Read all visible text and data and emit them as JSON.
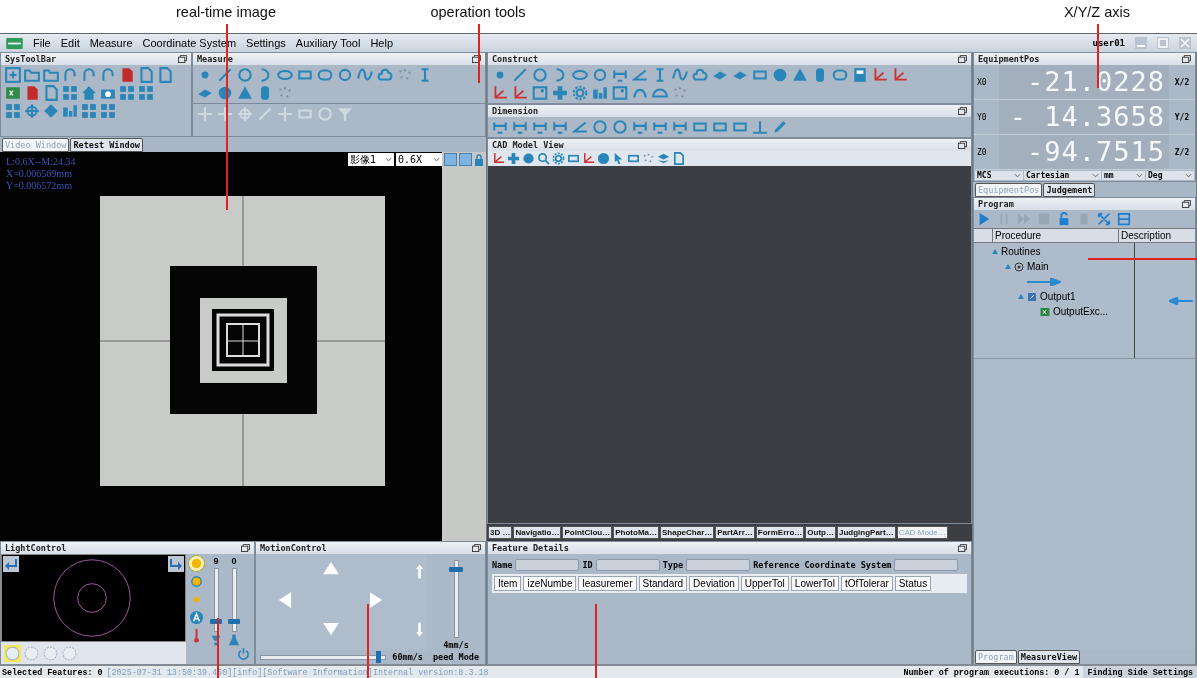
{
  "annotations": [
    {
      "label": "real-time image"
    },
    {
      "label": "operation tools"
    },
    {
      "label": "X/Y/Z axis"
    }
  ],
  "menu": [
    "File",
    "Edit",
    "Measure",
    "Coordinate System",
    "Settings",
    "Auxiliary Tool",
    "Help"
  ],
  "user": "user01",
  "systoolbar": {
    "title": "SysToolBar"
  },
  "measure": {
    "title": "Measure"
  },
  "video": {
    "tabs": [
      {
        "label": "Video Window",
        "selected": true
      },
      {
        "label": "Retest Window",
        "selected": false
      }
    ],
    "overlay": [
      "L:0.6X--M:24.34",
      "X=0.006569mm",
      "Y=0.006572mm"
    ],
    "camera": "影像1",
    "zoom": "0.6X"
  },
  "light_control": {
    "title": "LightControl",
    "ring_modes": [
      {
        "selected": true
      },
      {
        "selected": false
      },
      {
        "selected": false
      },
      {
        "selected": false
      }
    ],
    "sources": [
      {
        "selected": true
      },
      {
        "selected": false
      },
      {
        "selected": false
      }
    ],
    "sliders": [
      {
        "reading": "9",
        "level": 0.12
      },
      {
        "reading": "0",
        "level": 0.12
      }
    ]
  },
  "motion_control": {
    "title": "MotionControl",
    "speed": {
      "reading": "60mm/s",
      "level": 0.95
    },
    "z_speed": {
      "reading": "4mm/s",
      "level": 0.85
    },
    "mode": "peed Mode"
  },
  "construct": {
    "title": "Construct"
  },
  "dimension": {
    "title": "Dimension"
  },
  "cad_view": {
    "title": "CAD Model View"
  },
  "view_tabs": [
    {
      "label": "3D …",
      "selected": false
    },
    {
      "label": "Navigatio…",
      "selected": false
    },
    {
      "label": "PointClou…",
      "selected": false
    },
    {
      "label": "PhotoMa…",
      "selected": false
    },
    {
      "label": "ShapeChar…",
      "selected": false
    },
    {
      "label": "PartArr…",
      "selected": false
    },
    {
      "label": "FormErro…",
      "selected": false
    },
    {
      "label": "Outp…",
      "selected": false
    },
    {
      "label": "JudgingPart…",
      "selected": false
    },
    {
      "label": "CAD Mode…",
      "selected": true
    }
  ],
  "feature_details": {
    "title": "Feature Details",
    "fields": [
      {
        "label": "Name"
      },
      {
        "label": "ID"
      },
      {
        "label": "Type"
      },
      {
        "label": "Reference Coordinate System"
      }
    ],
    "columns": [
      "Item",
      "izeNumbe",
      "leasuremer",
      "Standard",
      "Deviation",
      "UpperTol",
      "LowerTol",
      "tOfTolerar",
      "Status"
    ]
  },
  "equipment_pos": {
    "title": "EquipmentPos",
    "axes": [
      {
        "name": "X0",
        "value": "-21.0228",
        "unit": "X/2"
      },
      {
        "name": "Y0",
        "value": "- 14.3658",
        "unit": "Y/2"
      },
      {
        "name": "Z0",
        "value": "-94.7515",
        "unit": "Z/2"
      }
    ],
    "selectors": [
      "MCS",
      "Cartesian",
      "mm",
      "Deg"
    ]
  },
  "right_tabs": [
    {
      "label": "EquipmentPos",
      "selected": true
    },
    {
      "label": "Judgement",
      "selected": false
    }
  ],
  "program": {
    "title": "Program",
    "columns": [
      "Procedure",
      "Description"
    ],
    "tree": [
      {
        "label": "Routines",
        "expanded": true,
        "children": [
          {
            "kind": "main",
            "label": "Main",
            "expanded": true,
            "children": [
              {
                "kind": "arrow"
              },
              {
                "kind": "output",
                "label": "Output1",
                "expanded": true,
                "children": [
                  {
                    "kind": "sheet",
                    "label": "OutputExc..."
                  }
                ]
              }
            ]
          }
        ]
      }
    ]
  },
  "bottom_tabs": [
    {
      "label": "Program",
      "selected": true
    },
    {
      "label": "MeasureView",
      "selected": false
    }
  ],
  "status_bar": {
    "selected": "Selected Features: 0",
    "log": "[2025-07-31 13:50:39.460][info][Software Information]Internal version:8.3.18",
    "executions": "Number of program executions: 0 / 1",
    "settings": "Finding Side Settings"
  }
}
